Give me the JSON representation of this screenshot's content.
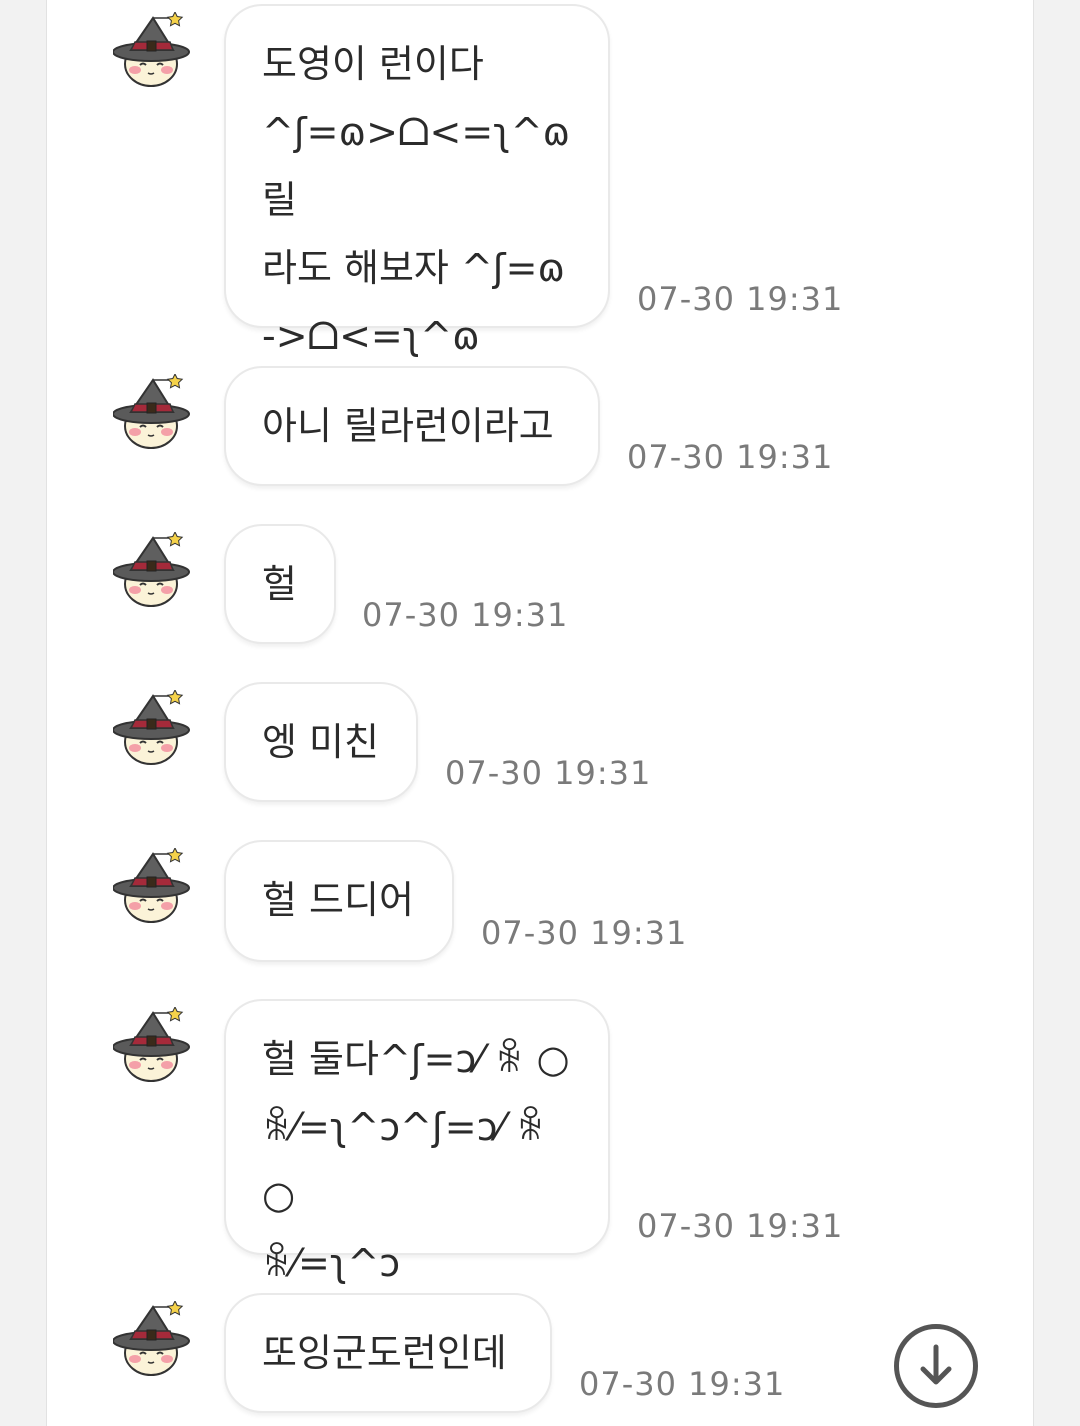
{
  "messages": [
    {
      "text": "도영이 런이다\n^ʃ=ɷ>ᗝ<=ʅ^ɷ 릴\n라도 해보자 ^ʃ=ɷ\n->ᗝ<=ʅ^ɷ",
      "time": "07-30 19:31"
    },
    {
      "text": "아니 릴라런이라고",
      "time": "07-30 19:31"
    },
    {
      "text": "헐",
      "time": "07-30 19:31"
    },
    {
      "text": "엥 미친",
      "time": "07-30 19:31"
    },
    {
      "text": "헐 드디어",
      "time": "07-30 19:31"
    },
    {
      "text": "헐 둘다^ʃ=ɔ⁄ ꆜ ○\nꆜ⁄=ʅ^ɔ^ʃ=ɔ⁄ ꆜ ○\nꆜ⁄=ʅ^ɔ",
      "time": "07-30 19:31"
    },
    {
      "text": "또잉군도런인데",
      "time": "07-30 19:31"
    }
  ],
  "avatar_icon": "witch-hat-character-icon",
  "scroll_button_icon": "arrow-down-circle-icon",
  "colors": {
    "background": "#f2f2f2",
    "panel": "#ffffff",
    "bubble_border": "#e9e9e9",
    "text": "#2b2b2b",
    "time": "#7a7a7a"
  }
}
